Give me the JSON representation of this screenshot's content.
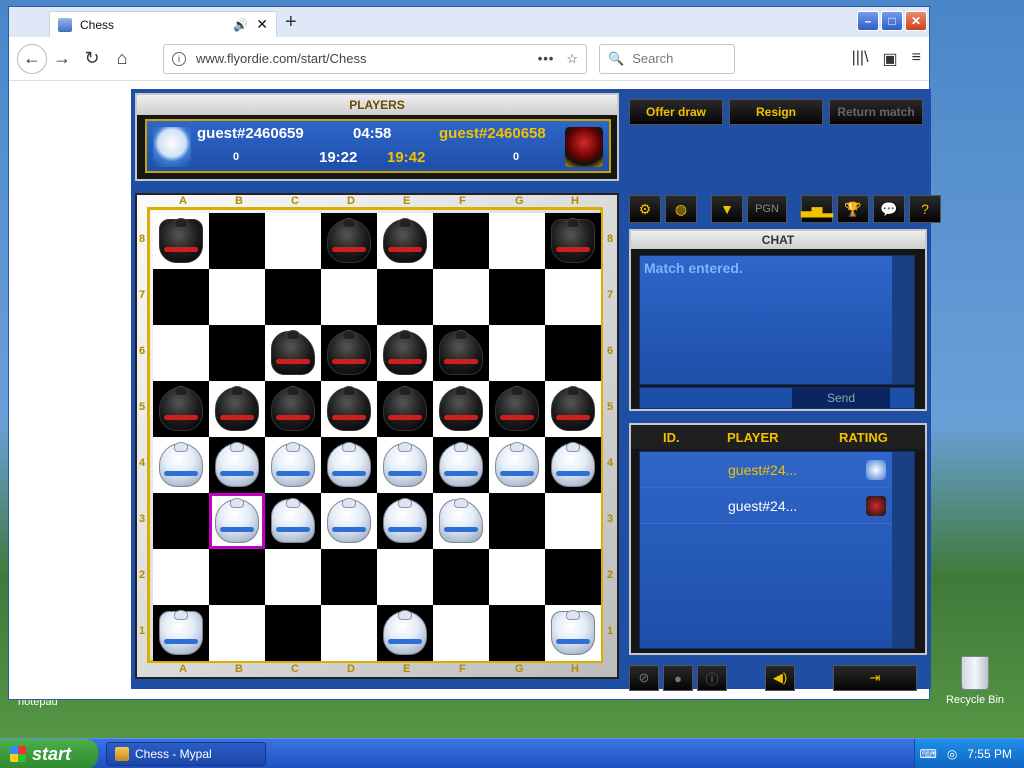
{
  "browser": {
    "tab_title": "Chess",
    "url": "www.flyordie.com/start/Chess",
    "search_placeholder": "Search",
    "icons": [
      "back-icon",
      "forward-icon",
      "reload-icon",
      "home-icon",
      "info-icon",
      "star-icon",
      "library-icon",
      "sidebar-icon",
      "menu-icon"
    ]
  },
  "game": {
    "players_header": "PLAYERS",
    "white_player": "guest#2460659",
    "black_player": "guest#2460658",
    "move_time": "04:58",
    "white_score": "0",
    "black_score": "0",
    "white_clock": "19:22",
    "black_clock": "19:42",
    "buttons": {
      "offer_draw": "Offer draw",
      "resign": "Resign",
      "return_match": "Return match"
    },
    "pgn_label": "PGN",
    "files": [
      "A",
      "B",
      "C",
      "D",
      "E",
      "F",
      "G",
      "H"
    ],
    "ranks": [
      "8",
      "7",
      "6",
      "5",
      "4",
      "3",
      "2",
      "1"
    ],
    "chat_header": "CHAT",
    "chat_message": "Match entered.",
    "send_label": "Send",
    "list_headers": {
      "id": "ID.",
      "player": "PLAYER",
      "rating": "RATING"
    },
    "list_rows": [
      {
        "name": "guest#24...",
        "color": "white",
        "text_color": "#f2c200"
      },
      {
        "name": "guest#24...",
        "color": "black",
        "text_color": "#ffffff"
      }
    ],
    "board": [
      [
        "br",
        "",
        "",
        "bq",
        "bk",
        "",
        "",
        "br"
      ],
      [
        "",
        "",
        "",
        "",
        "",
        "",
        "",
        ""
      ],
      [
        "",
        "",
        "bn",
        "bb",
        "bb",
        "bn",
        "",
        ""
      ],
      [
        "bp",
        "bp",
        "bp",
        "bp",
        "bp",
        "bp",
        "bp",
        "bp"
      ],
      [
        "wp",
        "wp",
        "wp",
        "wp",
        "wp",
        "wp",
        "wp",
        "wp"
      ],
      [
        "",
        "wq",
        "wn",
        "wb",
        "wb",
        "wn",
        "",
        ""
      ],
      [
        "",
        "",
        "",
        "",
        "",
        "",
        "",
        ""
      ],
      [
        "wr",
        "",
        "",
        "",
        "wk",
        "",
        "",
        "wr"
      ]
    ],
    "selected_square": "b3"
  },
  "desktop": {
    "recycle_label": "Recycle Bin",
    "notepad_label": "notepad"
  },
  "taskbar": {
    "start_label": "start",
    "task_label": "Chess - Mypal",
    "clock": "7:55 PM"
  }
}
